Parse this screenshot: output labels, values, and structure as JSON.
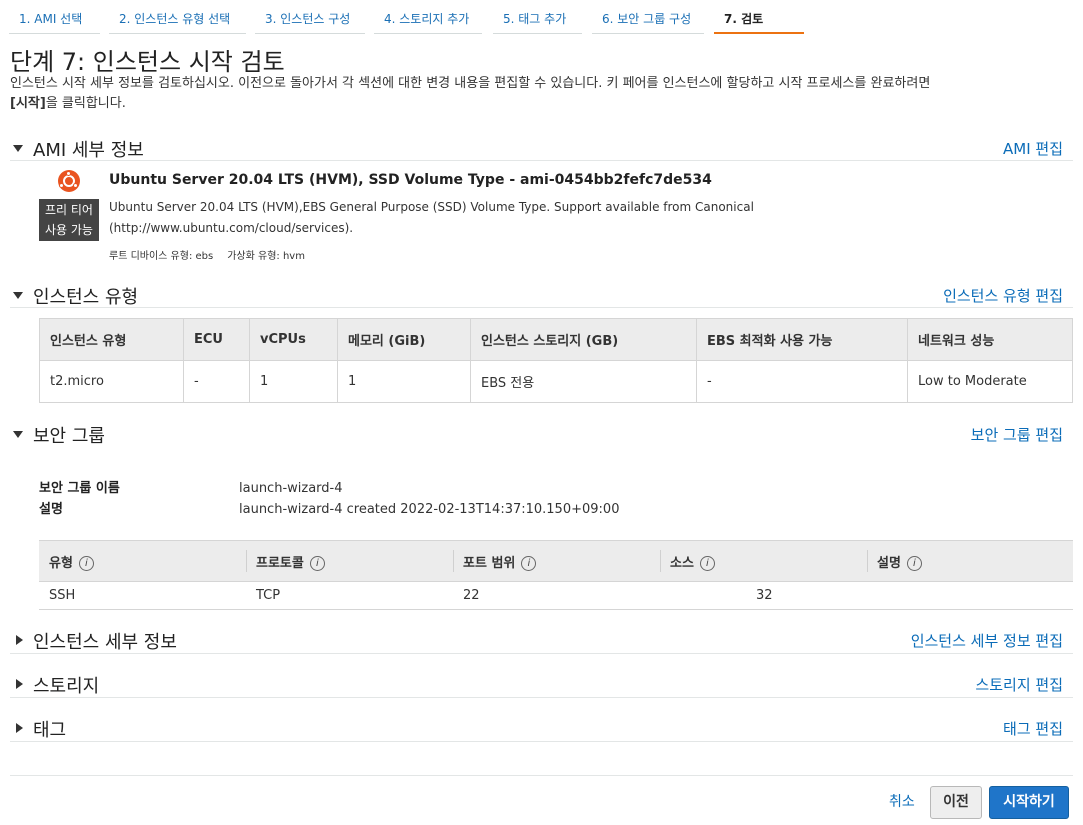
{
  "wizard_tabs": [
    {
      "label": "1. AMI 선택"
    },
    {
      "label": "2. 인스턴스 유형 선택"
    },
    {
      "label": "3. 인스턴스 구성"
    },
    {
      "label": "4. 스토리지 추가"
    },
    {
      "label": "5. 태그 추가"
    },
    {
      "label": "6. 보안 그룹 구성"
    },
    {
      "label": "7. 검토",
      "active": true
    }
  ],
  "page": {
    "title": "단계 7: 인스턴스 시작 검토",
    "intro_line1": "인스턴스 시작 세부 정보를 검토하십시오. 이전으로 돌아가서 각 섹션에 대한 변경 내용을 편집할 수 있습니다. 키 페어를 인스턴스에 할당하고 시작 프로세스를 완료하려면",
    "intro_bold": "[시작]",
    "intro_line2": "을 클릭합니다."
  },
  "ami_section": {
    "title": "AMI 세부 정보",
    "edit_label": "AMI 편집",
    "logo_icon": "ubuntu-logo-icon",
    "badge_line1": "프리 티어",
    "badge_line2": "사용 가능",
    "name": "Ubuntu Server 20.04 LTS (HVM), SSD Volume Type - ami-0454bb2fefc7de534",
    "desc_line1": "Ubuntu Server 20.04 LTS (HVM),EBS General Purpose (SSD) Volume Type. Support available from Canonical",
    "desc_line2": "(http://www.ubuntu.com/cloud/services).",
    "root_device": "루트 디바이스 유형: ebs",
    "virtualization": "가상화 유형: hvm"
  },
  "instance_type_section": {
    "title": "인스턴스 유형",
    "edit_label": "인스턴스 유형 편집",
    "columns": [
      "인스턴스 유형",
      "ECU",
      "vCPUs",
      "메모리 (GiB)",
      "인스턴스 스토리지 (GB)",
      "EBS 최적화 사용 가능",
      "네트워크 성능"
    ],
    "row": [
      "t2.micro",
      "-",
      "1",
      "1",
      "EBS 전용",
      "-",
      "Low to Moderate"
    ]
  },
  "security_group_section": {
    "title": "보안 그룹",
    "edit_label": "보안 그룹 편집",
    "name_label": "보안 그룹 이름",
    "name_value": "launch-wizard-4",
    "desc_label": "설명",
    "desc_value": "launch-wizard-4 created 2022-02-13T14:37:10.150+09:00",
    "columns": [
      "유형",
      "프로토콜",
      "포트 범위",
      "소스",
      "설명"
    ],
    "info_icon_text": "i",
    "rule_row": {
      "type": "SSH",
      "protocol": "TCP",
      "port": "22",
      "source": "32",
      "desc": ""
    }
  },
  "collapsed_sections": [
    {
      "title": "인스턴스 세부 정보",
      "edit_label": "인스턴스 세부 정보 편집"
    },
    {
      "title": "스토리지",
      "edit_label": "스토리지 편집"
    },
    {
      "title": "태그",
      "edit_label": "태그 편집"
    }
  ],
  "footer": {
    "cancel_label": "취소",
    "prev_label": "이전",
    "launch_label": "시작하기"
  },
  "colors": {
    "accent_tab": "#ec7211",
    "link": "#0b6cb8",
    "primary_button": "#1f75c9",
    "ubuntu": "#e95420"
  }
}
